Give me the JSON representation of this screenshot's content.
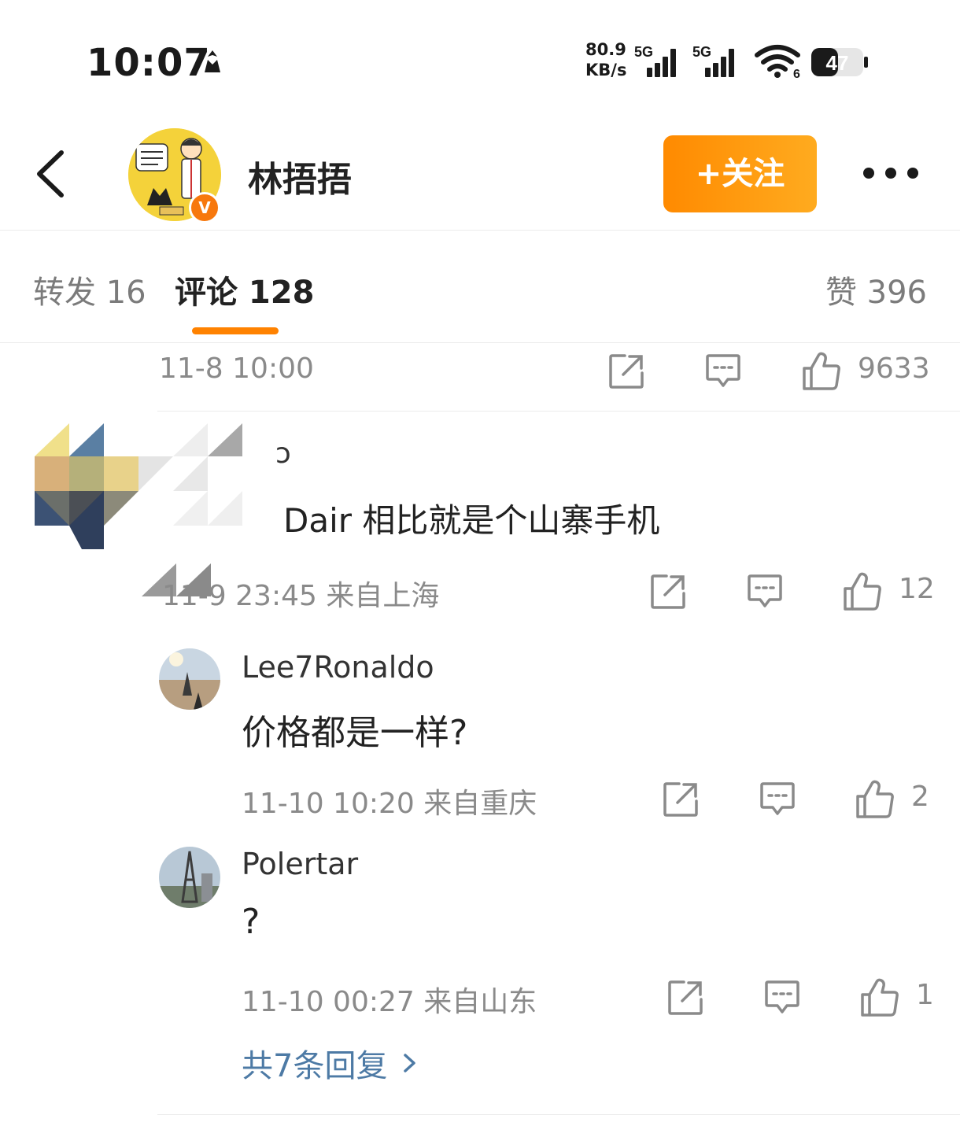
{
  "status_bar": {
    "time": "10:07",
    "net_speed_value": "80.9",
    "net_speed_unit": "KB/s",
    "signal1_label": "5G",
    "signal2_label": "5G",
    "wifi_label": "6",
    "battery_level": "47"
  },
  "header": {
    "username": "林捂捂",
    "verified_badge": "V",
    "follow_label": "+关注"
  },
  "tabs": {
    "repost_label": "转发 16",
    "comment_label": "评论 128",
    "like_label": "赞 396"
  },
  "top_meta": {
    "time": "11-8 10:00",
    "likes": "9633"
  },
  "comment": {
    "name_partial": "ɔ",
    "text": "Dair 相比就是个山寨手机",
    "time": "11-9 23:45  来自上海",
    "likes": "12"
  },
  "replies": [
    {
      "name": "Lee7Ronaldo",
      "text": "价格都是一样?",
      "time": "11-10 10:20  来自重庆",
      "likes": "2"
    },
    {
      "name": "Polertar",
      "text": "?",
      "time": "11-10 00:27  来自山东",
      "likes": "1"
    }
  ],
  "more_replies_label": "共7条回复",
  "colors": {
    "accent_orange": "#ff8200",
    "link_blue": "#4d7aa5",
    "meta_gray": "#8a8a8a"
  }
}
